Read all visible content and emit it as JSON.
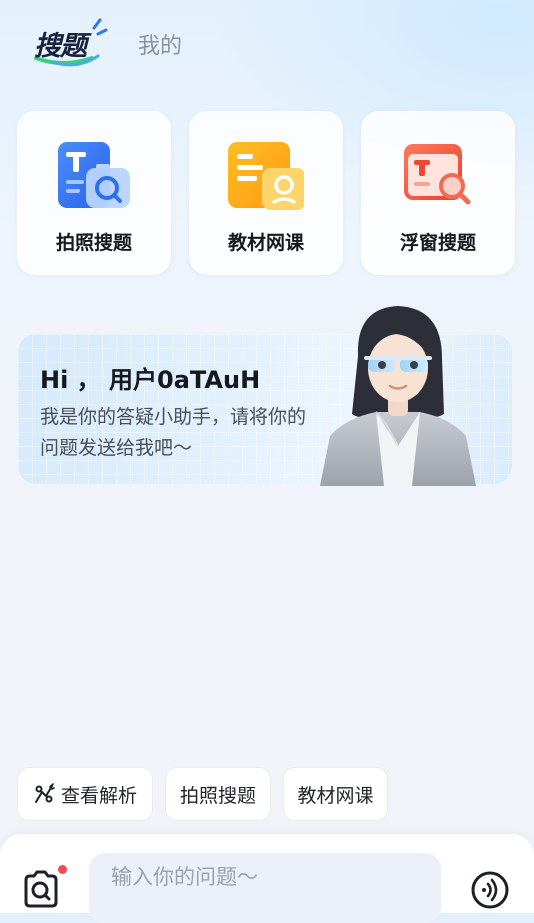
{
  "header": {
    "tab_search": "搜题",
    "tab_mine": "我的"
  },
  "cards": [
    {
      "label": "拍照搜题",
      "icon": "photo-search-icon"
    },
    {
      "label": "教材网课",
      "icon": "textbook-course-icon"
    },
    {
      "label": "浮窗搜题",
      "icon": "floating-window-search-icon"
    }
  ],
  "assistant": {
    "greeting": "Hi ， 用户0aTAuH",
    "intro": "我是你的答疑小助手，请将你的问题发送给我吧～"
  },
  "quick_actions": [
    {
      "label": "查看解析",
      "icon": "analysis-icon"
    },
    {
      "label": "拍照搜题"
    },
    {
      "label": "教材网课"
    }
  ],
  "input": {
    "placeholder": "输入你的问题～"
  },
  "colors": {
    "blue": "#3d7bf3",
    "orange": "#ffa41a",
    "red": "#f0563f",
    "notify_dot": "#f24b55"
  }
}
